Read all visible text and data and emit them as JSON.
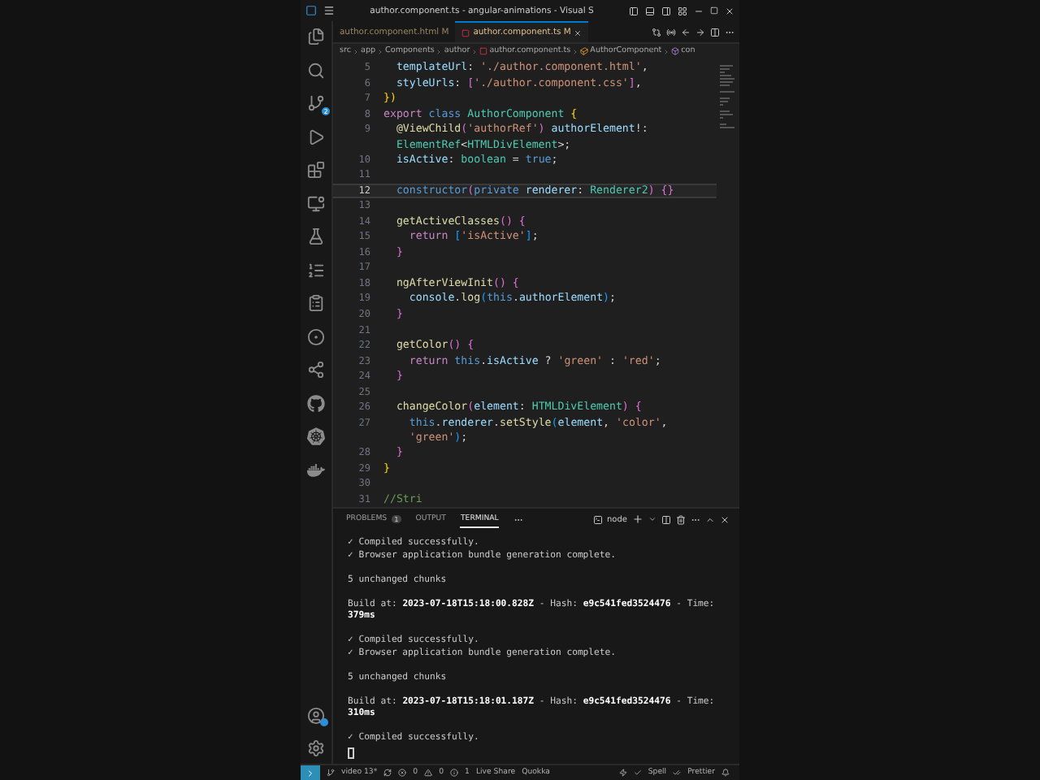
{
  "window": {
    "title": "author.component.ts - angular-animations - Visual S"
  },
  "activity_bar": {
    "scm_badge": "2"
  },
  "tabs": [
    {
      "label": "author.component.html M",
      "selected": false
    },
    {
      "label": "author.component.ts M",
      "selected": true
    }
  ],
  "breadcrumb": [
    {
      "label": "src",
      "kind": "folder"
    },
    {
      "label": "app",
      "kind": "folder"
    },
    {
      "label": "Components",
      "kind": "folder"
    },
    {
      "label": "author",
      "kind": "folder"
    },
    {
      "label": "author.component.ts",
      "kind": "file"
    },
    {
      "label": "AuthorComponent",
      "kind": "class"
    },
    {
      "label": "con",
      "kind": "method"
    }
  ],
  "editor": {
    "lines": [
      {
        "n": "5",
        "current": false,
        "tokens": [
          {
            "text": "  templateUrl",
            "kind": "variable"
          },
          {
            "text": ": ",
            "kind": "punct"
          },
          {
            "text": "'./author.component.html'",
            "kind": "string"
          },
          {
            "text": ",",
            "kind": "punct"
          }
        ]
      },
      {
        "n": "6",
        "current": false,
        "tokens": [
          {
            "text": "  styleUrls",
            "kind": "variable"
          },
          {
            "text": ": ",
            "kind": "punct"
          },
          {
            "text": "[",
            "kind": "bracket2"
          },
          {
            "text": "'./author.component.css'",
            "kind": "string"
          },
          {
            "text": "]",
            "kind": "bracket2"
          },
          {
            "text": ",",
            "kind": "punct"
          }
        ]
      },
      {
        "n": "7",
        "current": false,
        "tokens": [
          {
            "text": "})",
            "kind": "bracket1"
          }
        ]
      },
      {
        "n": "8",
        "current": false,
        "tokens": [
          {
            "text": "export",
            "kind": "control"
          },
          {
            "text": " class ",
            "kind": "keyword"
          },
          {
            "text": "AuthorComponent",
            "kind": "type"
          },
          {
            "text": " {",
            "kind": "bracket1"
          }
        ]
      },
      {
        "n": "9",
        "current": false,
        "tokens": [
          {
            "text": "  @ViewChild",
            "kind": "function"
          },
          {
            "text": "(",
            "kind": "bracket2"
          },
          {
            "text": "'authorRef'",
            "kind": "string"
          },
          {
            "text": ")",
            "kind": "bracket2"
          },
          {
            "text": " authorElement",
            "kind": "variable"
          },
          {
            "text": "!:",
            "kind": "punct"
          }
        ],
        "wrap": [
          {
            "text": "  ElementRef",
            "kind": "type"
          },
          {
            "text": "<",
            "kind": "punct"
          },
          {
            "text": "HTMLDivElement",
            "kind": "type"
          },
          {
            "text": ">;",
            "kind": "punct"
          }
        ]
      },
      {
        "n": "10",
        "current": false,
        "tokens": [
          {
            "text": "  isActive",
            "kind": "variable"
          },
          {
            "text": ": ",
            "kind": "punct"
          },
          {
            "text": "boolean",
            "kind": "type"
          },
          {
            "text": " = ",
            "kind": "punct"
          },
          {
            "text": "true",
            "kind": "keyword"
          },
          {
            "text": ";",
            "kind": "punct"
          }
        ]
      },
      {
        "n": "11",
        "current": false
      },
      {
        "n": "12",
        "current": true,
        "tokens": [
          {
            "text": "  constructor",
            "kind": "keyword"
          },
          {
            "text": "(",
            "kind": "bracket2"
          },
          {
            "text": "private",
            "kind": "keyword"
          },
          {
            "text": " renderer",
            "kind": "variable"
          },
          {
            "text": ": ",
            "kind": "punct"
          },
          {
            "text": "Renderer2",
            "kind": "type"
          },
          {
            "text": ")",
            "kind": "bracket2"
          },
          {
            "text": " {}",
            "kind": "bracket2"
          }
        ]
      },
      {
        "n": "13",
        "current": false
      },
      {
        "n": "14",
        "current": false,
        "tokens": [
          {
            "text": "  getActiveClasses",
            "kind": "function"
          },
          {
            "text": "()",
            "kind": "bracket2"
          },
          {
            "text": " {",
            "kind": "bracket2"
          }
        ]
      },
      {
        "n": "15",
        "current": false,
        "tokens": [
          {
            "text": "    return ",
            "kind": "control"
          },
          {
            "text": "[",
            "kind": "bracket3"
          },
          {
            "text": "'isActive'",
            "kind": "string"
          },
          {
            "text": "]",
            "kind": "bracket3"
          },
          {
            "text": ";",
            "kind": "punct"
          }
        ]
      },
      {
        "n": "16",
        "current": false,
        "tokens": [
          {
            "text": "  }",
            "kind": "bracket2"
          }
        ]
      },
      {
        "n": "17",
        "current": false
      },
      {
        "n": "18",
        "current": false,
        "tokens": [
          {
            "text": "  ngAfterViewInit",
            "kind": "function"
          },
          {
            "text": "()",
            "kind": "bracket2"
          },
          {
            "text": " {",
            "kind": "bracket2"
          }
        ]
      },
      {
        "n": "19",
        "current": false,
        "tokens": [
          {
            "text": "    console",
            "kind": "variable"
          },
          {
            "text": ".",
            "kind": "punct"
          },
          {
            "text": "log",
            "kind": "function"
          },
          {
            "text": "(",
            "kind": "bracket3"
          },
          {
            "text": "this",
            "kind": "keyword"
          },
          {
            "text": ".",
            "kind": "punct"
          },
          {
            "text": "authorElement",
            "kind": "variable"
          },
          {
            "text": ")",
            "kind": "bracket3"
          },
          {
            "text": ";",
            "kind": "punct"
          }
        ]
      },
      {
        "n": "20",
        "current": false,
        "tokens": [
          {
            "text": "  }",
            "kind": "bracket2"
          }
        ]
      },
      {
        "n": "21",
        "current": false
      },
      {
        "n": "22",
        "current": false,
        "tokens": [
          {
            "text": "  getColor",
            "kind": "function"
          },
          {
            "text": "()",
            "kind": "bracket2"
          },
          {
            "text": " {",
            "kind": "bracket2"
          }
        ]
      },
      {
        "n": "23",
        "current": false,
        "tokens": [
          {
            "text": "    return",
            "kind": "control"
          },
          {
            "text": " this",
            "kind": "keyword"
          },
          {
            "text": ".",
            "kind": "punct"
          },
          {
            "text": "isActive",
            "kind": "variable"
          },
          {
            "text": " ? ",
            "kind": "punct"
          },
          {
            "text": "'green'",
            "kind": "string"
          },
          {
            "text": " : ",
            "kind": "punct"
          },
          {
            "text": "'red'",
            "kind": "string"
          },
          {
            "text": ";",
            "kind": "punct"
          }
        ]
      },
      {
        "n": "24",
        "current": false,
        "tokens": [
          {
            "text": "  }",
            "kind": "bracket2"
          }
        ]
      },
      {
        "n": "25",
        "current": false
      },
      {
        "n": "26",
        "current": false,
        "tokens": [
          {
            "text": "  changeColor",
            "kind": "function"
          },
          {
            "text": "(",
            "kind": "bracket2"
          },
          {
            "text": "element",
            "kind": "variable"
          },
          {
            "text": ": ",
            "kind": "punct"
          },
          {
            "text": "HTMLDivElement",
            "kind": "type"
          },
          {
            "text": ")",
            "kind": "bracket2"
          },
          {
            "text": " {",
            "kind": "bracket2"
          }
        ]
      },
      {
        "n": "27",
        "current": false,
        "tokens": [
          {
            "text": "    this",
            "kind": "keyword"
          },
          {
            "text": ".",
            "kind": "punct"
          },
          {
            "text": "renderer",
            "kind": "variable"
          },
          {
            "text": ".",
            "kind": "punct"
          },
          {
            "text": "setStyle",
            "kind": "function"
          },
          {
            "text": "(",
            "kind": "bracket3"
          },
          {
            "text": "element",
            "kind": "variable"
          },
          {
            "text": ", ",
            "kind": "punct"
          },
          {
            "text": "'color'",
            "kind": "string"
          },
          {
            "text": ",",
            "kind": "punct"
          }
        ],
        "wrap": [
          {
            "text": "    'green'",
            "kind": "string"
          },
          {
            "text": ")",
            "kind": "bracket3"
          },
          {
            "text": ";",
            "kind": "punct"
          }
        ]
      },
      {
        "n": "28",
        "current": false,
        "tokens": [
          {
            "text": "  }",
            "kind": "bracket2"
          }
        ]
      },
      {
        "n": "29",
        "current": false,
        "tokens": [
          {
            "text": "}",
            "kind": "bracket1"
          }
        ]
      },
      {
        "n": "30",
        "current": false
      },
      {
        "n": "31",
        "current": false,
        "tokens": [
          {
            "text": "//Stri",
            "kind": "comment"
          }
        ]
      }
    ]
  },
  "panel": {
    "tabs": [
      {
        "label": "PROBLEMS",
        "selected": false,
        "badge": "1"
      },
      {
        "label": "OUTPUT",
        "selected": false
      },
      {
        "label": "TERMINAL",
        "selected": true
      }
    ],
    "terminal_name": "node",
    "blocks": [
      [
        "✓ Compiled successfully.",
        "✓ Browser application bundle generation complete."
      ],
      [
        "5 unchanged chunks"
      ],
      [
        "Build at: **2023-07-18T15:18:00.828Z** - Hash: **e9c541fed3524476** - Time: **379ms**"
      ],
      [
        "✓ Compiled successfully.",
        "✓ Browser application bundle generation complete."
      ],
      [
        "5 unchanged chunks"
      ],
      [
        "Build at: **2023-07-18T15:18:01.187Z** - Hash: **e9c541fed3524476** - Time: **310ms**"
      ],
      [
        "✓ Compiled successfully."
      ]
    ]
  },
  "status_bar": {
    "branch": "video 13*",
    "errors": "0",
    "warnings": "0",
    "infos": "1",
    "items": [
      "Live Share",
      "Quokka"
    ],
    "right": [
      "Spell",
      "Prettier"
    ]
  }
}
